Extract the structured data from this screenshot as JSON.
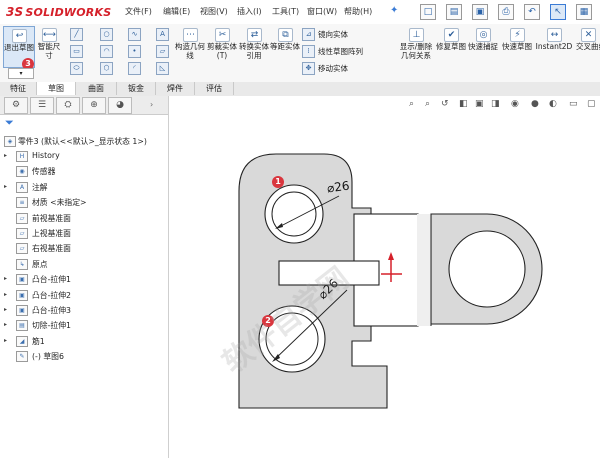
{
  "app": {
    "logo": "SOLIDWORKS",
    "logo_mark": "3S"
  },
  "menu": [
    "文件(F)",
    "编辑(E)",
    "视图(V)",
    "插入(I)",
    "工具(T)",
    "窗口(W)",
    "帮助(H)"
  ],
  "ribbon": {
    "exit_sketch": "退出草图",
    "smart_dim": "智能尺寸",
    "convert_entities": "构造几何线",
    "trim_entities": "剪裁实体(T)",
    "convert_ref": "转换实体引用",
    "offset_entities": "等距实体",
    "mirror": "镜向实体",
    "linear_pattern": "线性草图阵列",
    "move_entities": "移动实体",
    "display_delete": "显示/删除几何关系",
    "repair_sketch": "修复草图",
    "quick_snaps": "快速捕捉",
    "rapid_sketch": "快速草图",
    "instant2d": "Instant2D",
    "cross": "交叉曲线",
    "step_badge": "3"
  },
  "tabs": [
    "特征",
    "草图",
    "曲面",
    "钣金",
    "焊件",
    "评估"
  ],
  "active_tab_index": 1,
  "tree": {
    "root": "零件3 (默认<<默认>_显示状态 1>)",
    "items": [
      {
        "label": "History",
        "icon": "history-icon",
        "arrow": true
      },
      {
        "label": "传感器",
        "icon": "sensor-icon",
        "arrow": false
      },
      {
        "label": "注解",
        "icon": "annotation-icon",
        "arrow": true
      },
      {
        "label": "材质 <未指定>",
        "icon": "material-icon",
        "arrow": false
      },
      {
        "label": "前视基准面",
        "icon": "plane-icon",
        "arrow": false
      },
      {
        "label": "上视基准面",
        "icon": "plane-icon",
        "arrow": false
      },
      {
        "label": "右视基准面",
        "icon": "plane-icon",
        "arrow": false
      },
      {
        "label": "原点",
        "icon": "origin-icon",
        "arrow": false
      },
      {
        "label": "凸台-拉伸1",
        "icon": "extrude-icon",
        "arrow": true
      },
      {
        "label": "凸台-拉伸2",
        "icon": "extrude-icon",
        "arrow": true
      },
      {
        "label": "凸台-拉伸3",
        "icon": "extrude-icon",
        "arrow": true
      },
      {
        "label": "切除-拉伸1",
        "icon": "cut-icon",
        "arrow": true
      },
      {
        "label": "筋1",
        "icon": "rib-icon",
        "arrow": true
      },
      {
        "label": "(-) 草图6",
        "icon": "sketch-icon",
        "arrow": false
      }
    ]
  },
  "drawing": {
    "dim_top": "26",
    "dim_bottom": "26",
    "marker_1": "1",
    "marker_2": "2",
    "watermark": "软件自学网"
  },
  "colors": {
    "brand": "#d5202a",
    "marker": "#d9363e",
    "part_fill": "#d9d9d9"
  }
}
